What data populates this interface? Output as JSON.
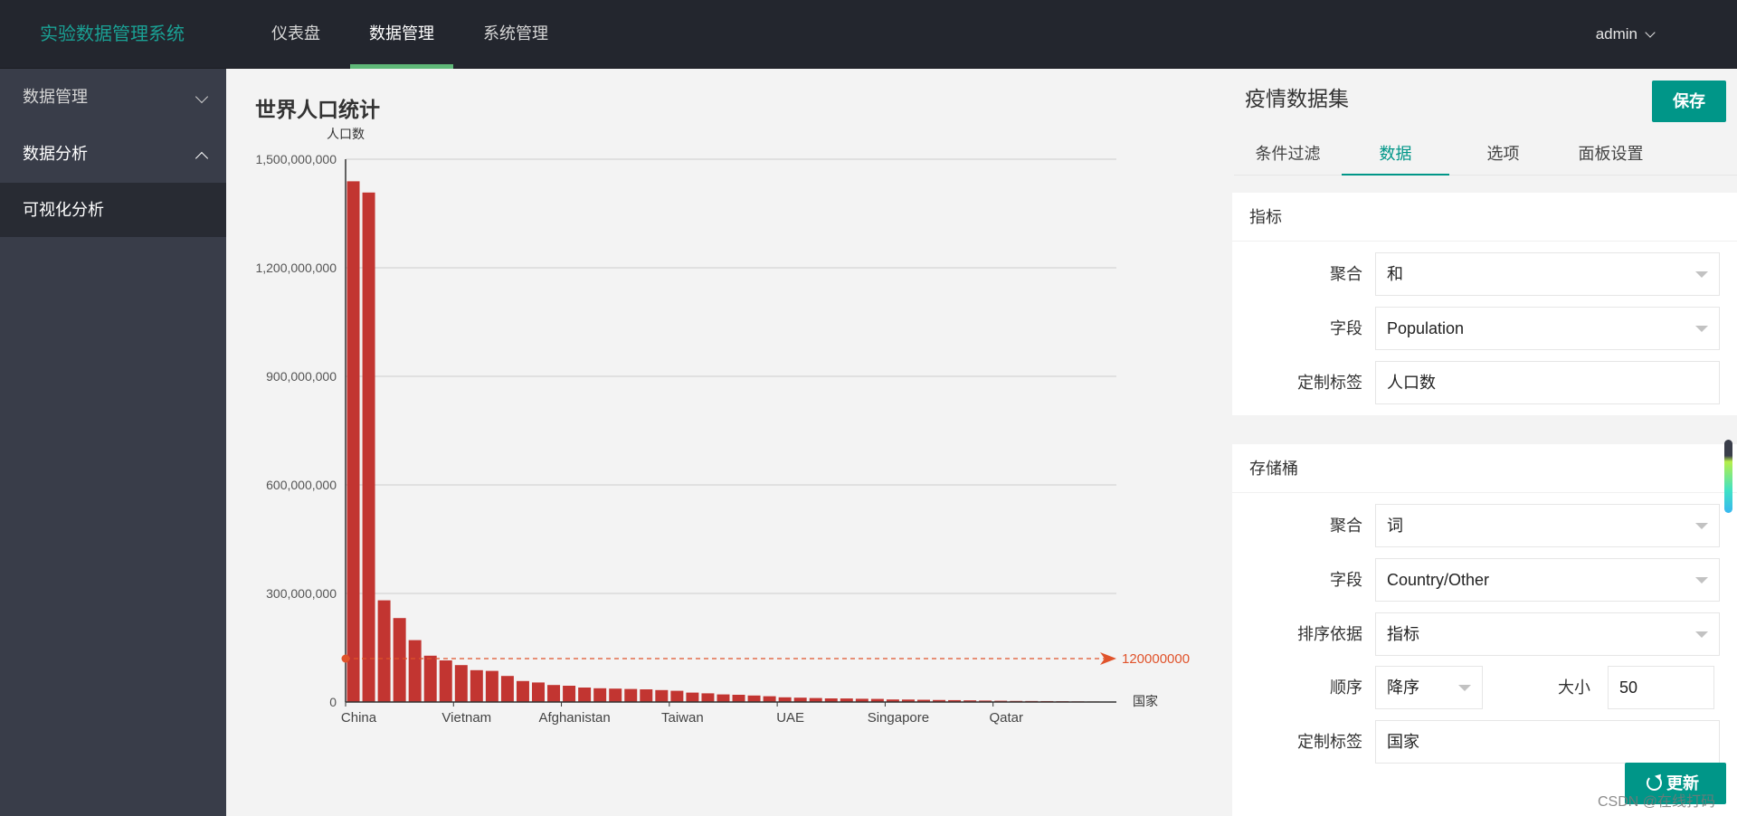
{
  "app": {
    "title": "实验数据管理系统"
  },
  "topnav": {
    "items": [
      "仪表盘",
      "数据管理",
      "系统管理"
    ],
    "active": "数据管理"
  },
  "user": {
    "name": "admin"
  },
  "sidebar": {
    "items": [
      {
        "label": "数据管理"
      },
      {
        "label": "数据分析"
      }
    ],
    "subitem": "可视化分析"
  },
  "chart_title": "世界人口统计",
  "chart_data": {
    "type": "bar",
    "title": "世界人口统计",
    "xlabel": "国家",
    "ylabel": "人口数",
    "ylim": [
      0,
      1500000000
    ],
    "yticks": [
      0,
      300000000,
      600000000,
      900000000,
      1200000000,
      1500000000
    ],
    "ytick_labels": [
      "0",
      "300,000,000",
      "600,000,000",
      "900,000,000",
      "1,200,000,000",
      "1,500,000,000"
    ],
    "shown_xtick_labels": [
      "China",
      "Vietnam",
      "Afghanistan",
      "Taiwan",
      "UAE",
      "Singapore",
      "Qatar"
    ],
    "categories": [
      "China",
      "",
      "",
      "",
      "",
      "",
      "",
      "Vietnam",
      "",
      "",
      "",
      "",
      "",
      "",
      "Afghanistan",
      "",
      "",
      "",
      "",
      "",
      "",
      "Taiwan",
      "",
      "",
      "",
      "",
      "",
      "",
      "UAE",
      "",
      "",
      "",
      "",
      "",
      "",
      "Singapore",
      "",
      "",
      "",
      "",
      "",
      "",
      "Qatar",
      "",
      "",
      "",
      "",
      "",
      "",
      ""
    ],
    "values": [
      1439000000,
      1408000000,
      281000000,
      232000000,
      171000000,
      128000000,
      115000000,
      102000000,
      88000000,
      86000000,
      72000000,
      58000000,
      54000000,
      47000000,
      45000000,
      40000000,
      38000000,
      37000000,
      36000000,
      35000000,
      33000000,
      31000000,
      26000000,
      24000000,
      21000000,
      20000000,
      18000000,
      16000000,
      13000000,
      12000000,
      11000000,
      10000000,
      9800000,
      9000000,
      8600000,
      7000000,
      6800000,
      6200000,
      5600000,
      5200000,
      4600000,
      4000000,
      3500000,
      3000000,
      2800000,
      2600000,
      2200000,
      1800000,
      1500000,
      1200000
    ],
    "bar_color": "#c23531",
    "markline": {
      "value": 120000000,
      "label": "120000000",
      "color": "#e0532b"
    },
    "grid": true
  },
  "panel": {
    "dataset_title": "疫情数据集",
    "save_label": "保存",
    "tabs": [
      "条件过滤",
      "数据",
      "选项",
      "面板设置"
    ],
    "active_tab": "数据",
    "metric": {
      "header": "指标",
      "agg_label": "聚合",
      "agg_value": "和",
      "field_label": "字段",
      "field_value": "Population",
      "custom_label": "定制标签",
      "custom_value": "人口数"
    },
    "bucket": {
      "header": "存储桶",
      "agg_label": "聚合",
      "agg_value": "词",
      "field_label": "字段",
      "field_value": "Country/Other",
      "sort_label": "排序依据",
      "sort_value": "指标",
      "order_label": "顺序",
      "order_value": "降序",
      "size_label": "大小",
      "size_value": "50",
      "custom_label": "定制标签",
      "custom_value": "国家"
    },
    "refresh_label": "更新"
  },
  "watermark": "CSDN @在线打码"
}
